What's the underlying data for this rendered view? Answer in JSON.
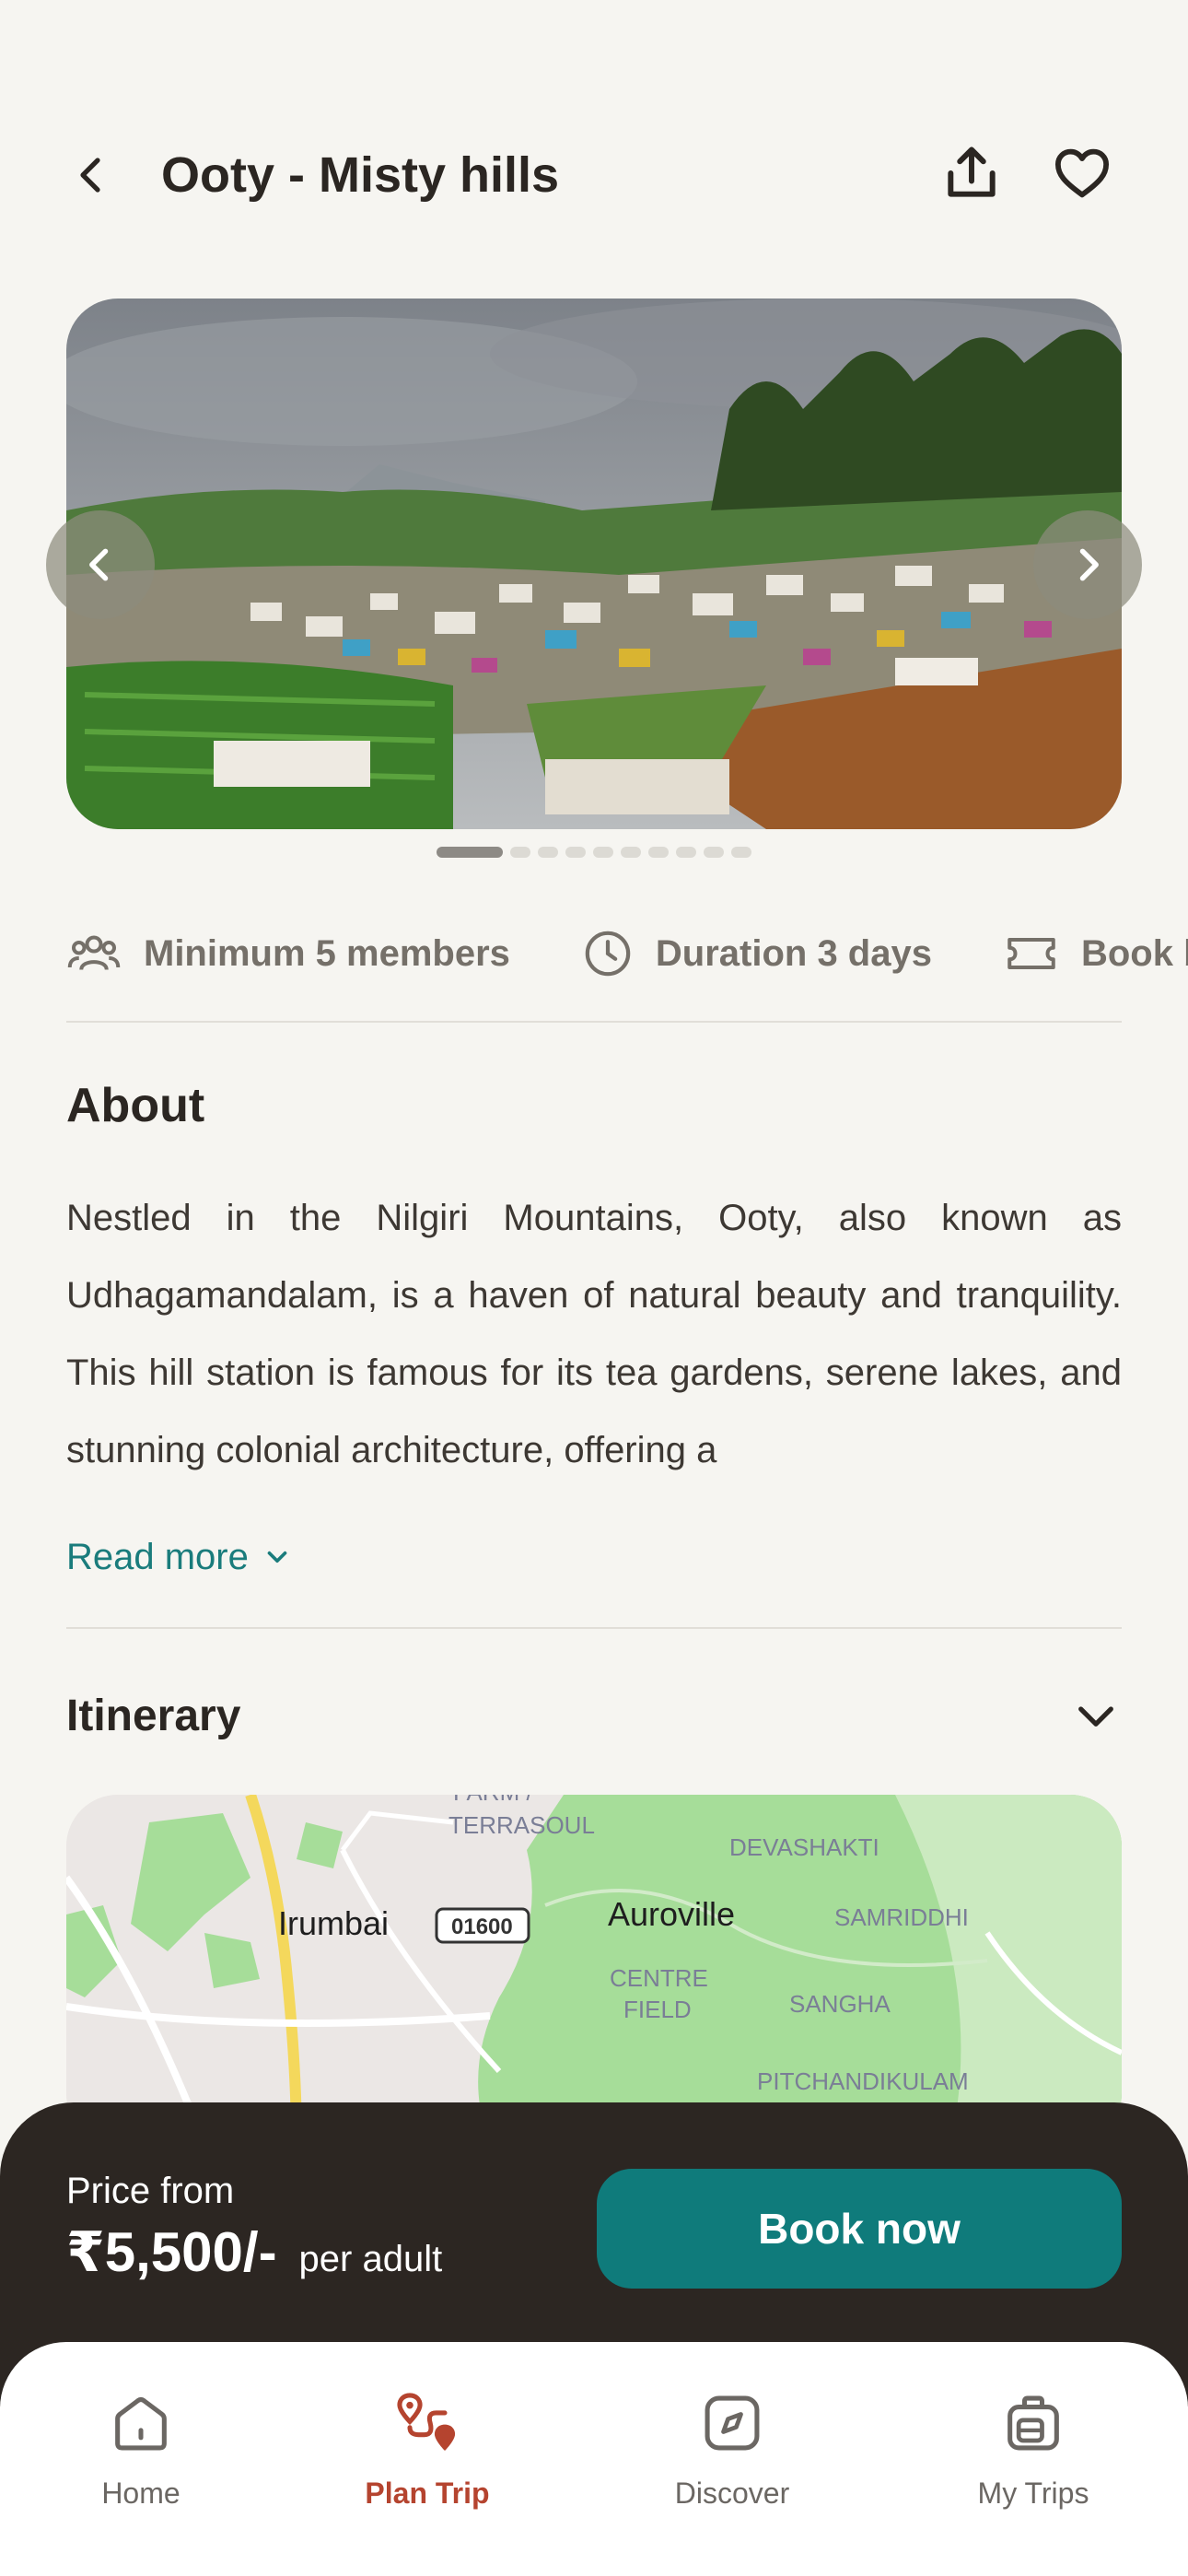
{
  "header": {
    "title": "Ooty - Misty hills",
    "back_icon": "chevron-left-icon",
    "share_icon": "share-icon",
    "favorite_icon": "heart-icon"
  },
  "carousel": {
    "image_description_icon": "hero-photo",
    "total_slides": 10,
    "active_slide": 1
  },
  "info_chips": [
    {
      "icon": "group-icon",
      "label": "Minimum 5 members"
    },
    {
      "icon": "clock-icon",
      "label": "Duration 3 days"
    },
    {
      "icon": "ticket-icon",
      "label": "Book b"
    }
  ],
  "about": {
    "title": "About",
    "text": "Nestled in the Nilgiri Mountains, Ooty, also known as Udhagamandalam, is a haven of natural beauty and tranquility. This hill station is famous for its tea gardens, serene lakes, and stunning colonial architecture, offering a",
    "read_more": "Read more"
  },
  "itinerary": {
    "title": "Itinerary",
    "map_labels": {
      "farm": "FARM /",
      "terrasoul": "TERRASOUL",
      "devashakti": "DEVASHAKTI",
      "irumbai": "Irumbai",
      "road_code": "01600",
      "auroville": "Auroville",
      "samriddhi": "SAMRIDDHI",
      "centre": "CENTRE",
      "field": "FIELD",
      "sangha": "SANGHA",
      "pitchandikulam": "PITCHANDIKULAM"
    }
  },
  "price": {
    "label": "Price from",
    "value": "₹5,500/-",
    "unit": "per adult",
    "book_label": "Book now"
  },
  "nav": [
    {
      "label": "Home",
      "icon": "home-icon",
      "active": false
    },
    {
      "label": "Plan Trip",
      "icon": "route-icon",
      "active": true
    },
    {
      "label": "Discover",
      "icon": "compass-icon",
      "active": false
    },
    {
      "label": "My Trips",
      "icon": "luggage-icon",
      "active": false
    }
  ],
  "colors": {
    "background": "#f6f5f1",
    "accent": "#0f7b7b",
    "active_nav": "#b5442f",
    "price_bar": "#2c2622"
  }
}
